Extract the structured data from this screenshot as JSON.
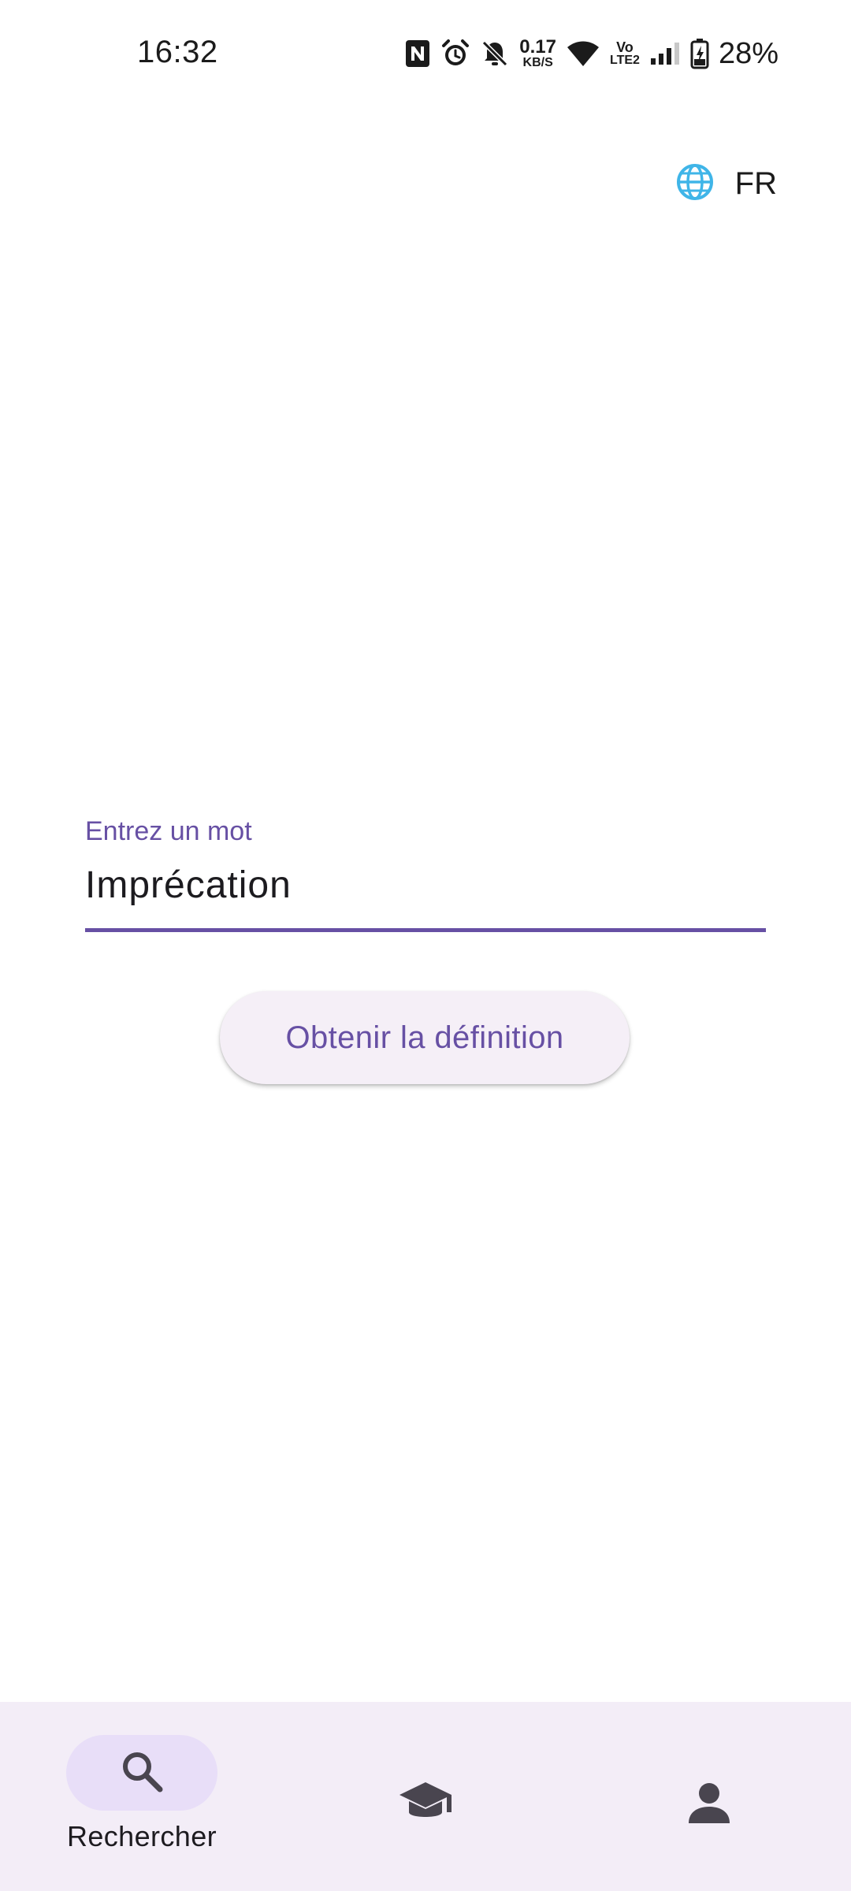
{
  "status_bar": {
    "time": "16:32",
    "net_speed_value": "0.17",
    "net_speed_unit": "KB/S",
    "volte_top": "Vo",
    "volte_bottom": "LTE2",
    "battery_percent": "28%",
    "icons": [
      "nfc-icon",
      "alarm-icon",
      "bell-off-icon",
      "wifi-icon",
      "signal-icon",
      "battery-charging-icon"
    ]
  },
  "language": {
    "icon": "globe-icon",
    "label": "FR",
    "icon_color": "#3fb5e8"
  },
  "search_form": {
    "label": "Entrez un mot",
    "value": "Imprécation",
    "button_label": "Obtenir la définition"
  },
  "bottom_nav": {
    "items": [
      {
        "icon": "search-icon",
        "label": "Rechercher",
        "active": true
      },
      {
        "icon": "school-icon",
        "label": "",
        "active": false
      },
      {
        "icon": "person-icon",
        "label": "",
        "active": false
      }
    ]
  },
  "colors": {
    "accent": "#6750a4",
    "nav_background": "#f3edf7",
    "nav_active_pill": "#e8def8",
    "button_background": "#f5eff7"
  }
}
